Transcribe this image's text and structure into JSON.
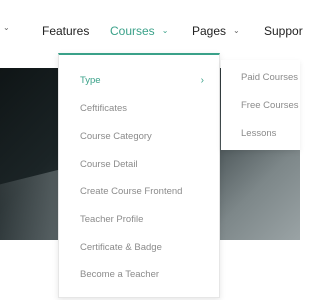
{
  "nav": {
    "items": [
      {
        "label": "",
        "has_chevron": true
      },
      {
        "label": "Features",
        "has_chevron": false
      },
      {
        "label": "Courses",
        "has_chevron": true,
        "active": true
      },
      {
        "label": "Pages",
        "has_chevron": true
      },
      {
        "label": "Suppor",
        "has_chevron": false
      }
    ]
  },
  "dropdown": {
    "items": [
      {
        "label": "Type",
        "active": true,
        "has_submenu": true
      },
      {
        "label": "Ceftificates"
      },
      {
        "label": "Course Category"
      },
      {
        "label": "Course Detail"
      },
      {
        "label": "Create Course Frontend"
      },
      {
        "label": "Teacher Profile"
      },
      {
        "label": "Certificate & Badge"
      },
      {
        "label": "Become a Teacher"
      }
    ],
    "submenu_arrow": "›"
  },
  "submenu": {
    "items": [
      {
        "label": "Paid Courses"
      },
      {
        "label": "Free Courses"
      },
      {
        "label": "Lessons"
      }
    ]
  },
  "colors": {
    "accent": "#3aa189",
    "menu_text": "#8b8b8b",
    "nav_text": "#222222"
  },
  "icons": {
    "chevron": "chevron-down-icon",
    "submenu_arrow": "chevron-right-icon"
  }
}
